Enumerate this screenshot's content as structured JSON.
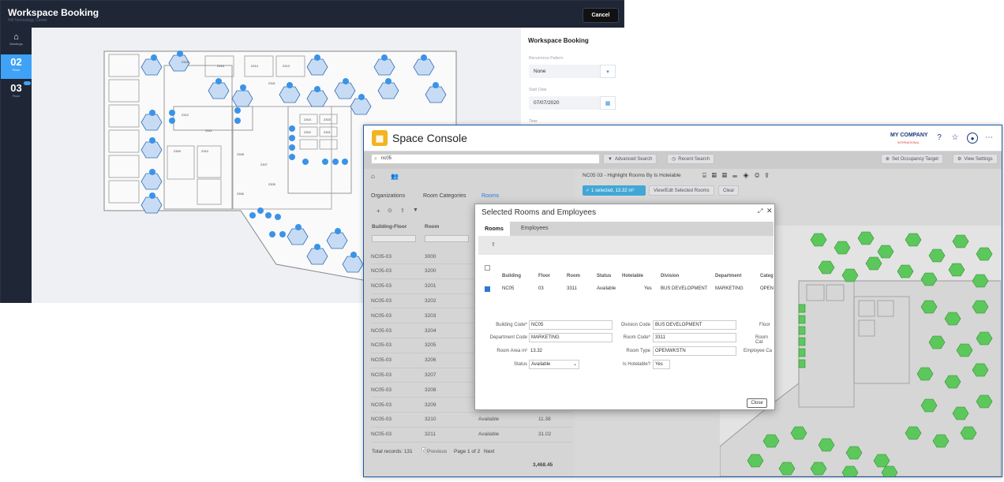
{
  "workspace": {
    "title": "Workspace Booking",
    "subtitle": "Hill Technology Center",
    "cancel_label": "Cancel",
    "sidebar": [
      {
        "label": "Buildings"
      },
      {
        "number": "02",
        "label": "Floor"
      },
      {
        "number": "03",
        "label": "Floor"
      }
    ],
    "panel": {
      "title": "Workspace Booking",
      "recurrence_label": "Recurrence Pattern",
      "recurrence_value": "None",
      "start_date_label": "Start Date",
      "start_date_value": "07/07/2020",
      "time_label": "Time"
    },
    "room_labels": [
      "2316",
      "2315",
      "2314",
      "2313",
      "2312",
      "2311",
      "2310",
      "2309",
      "2308",
      "2307",
      "2305",
      "2304",
      "2303",
      "2302",
      "2301",
      "2341",
      "2306"
    ]
  },
  "console": {
    "title": "Space Console",
    "company": "MY COMPANY",
    "company_sub": "INTERNATIONAL",
    "search_value": "nc05",
    "advanced_search": "Advanced Search",
    "recent_search": "Recent Search",
    "set_occupancy": "Set Occupancy Target",
    "view_settings": "View Settings",
    "left_tabs": [
      "Organizations",
      "Room Categories",
      "Rooms"
    ],
    "col_building_floor": "Building-Floor",
    "col_room": "Room",
    "rows": [
      {
        "bf": "NC05-03",
        "room": "3000",
        "status": "",
        "area": ""
      },
      {
        "bf": "NC05-03",
        "room": "3200",
        "status": "",
        "area": ""
      },
      {
        "bf": "NC05-03",
        "room": "3201",
        "status": "",
        "area": ""
      },
      {
        "bf": "NC05-03",
        "room": "3202",
        "status": "",
        "area": ""
      },
      {
        "bf": "NC05-03",
        "room": "3203",
        "status": "",
        "area": ""
      },
      {
        "bf": "NC05-03",
        "room": "3204",
        "status": "",
        "area": ""
      },
      {
        "bf": "NC05-03",
        "room": "3205",
        "status": "",
        "area": ""
      },
      {
        "bf": "NC05-03",
        "room": "3206",
        "status": "",
        "area": ""
      },
      {
        "bf": "NC05-03",
        "room": "3207",
        "status": "",
        "area": ""
      },
      {
        "bf": "NC05-03",
        "room": "3208",
        "status": "",
        "area": ""
      },
      {
        "bf": "NC05-03",
        "room": "3209",
        "status": "",
        "area": ""
      },
      {
        "bf": "NC05-03",
        "room": "3210",
        "status": "Available",
        "area": "11.38"
      },
      {
        "bf": "NC05-03",
        "room": "3211",
        "status": "Available",
        "area": "31.02"
      }
    ],
    "total_records": "Total records: 131",
    "previous": "Previous",
    "page": "Page 1 of 2",
    "next": "Next",
    "total_area": "3,468.45",
    "right_title": "NC05 03 - Highlight Rooms By Is Hotelable",
    "selected_badge": "1 selected, 13.32 m²",
    "view_edit": "View/Edit Selected Rooms",
    "clear": "Clear"
  },
  "modal": {
    "title": "Selected Rooms and Employees",
    "tabs": [
      "Rooms",
      "Employees"
    ],
    "headers": [
      "Building",
      "Floor",
      "Room",
      "Status",
      "Hotelable",
      "Division",
      "Department",
      "Categ"
    ],
    "row": [
      "NC05",
      "03",
      "3311",
      "Available",
      "Yes",
      "BUS DEVELOPMENT",
      "MARKETING",
      "OPEN"
    ],
    "fields": {
      "building_code_label": "Building Code*",
      "building_code": "NC05",
      "department_code_label": "Department Code",
      "department_code": "MARKETING",
      "room_area_label": "Room Area m²",
      "room_area": "13.32",
      "status_label": "Status",
      "status": "Available",
      "division_code_label": "Division Code",
      "division_code": "BUS DEVELOPMENT",
      "room_code_label": "Room Code*",
      "room_code": "3311",
      "room_type_label": "Room Type",
      "room_type": "OPENWKSTN",
      "hotelable_label": "Is Hotelable?",
      "hotelable": "Yes",
      "floor_cut": "Floor",
      "room_cat_cut": "Room Cat",
      "employee_cat_cut": "Employee Ca"
    },
    "close_label": "Close"
  },
  "colors": {
    "accent": "#3fa2f7",
    "console_blue": "#1b3a7a",
    "green": "#5cc85c",
    "badge": "#42a7d6"
  }
}
